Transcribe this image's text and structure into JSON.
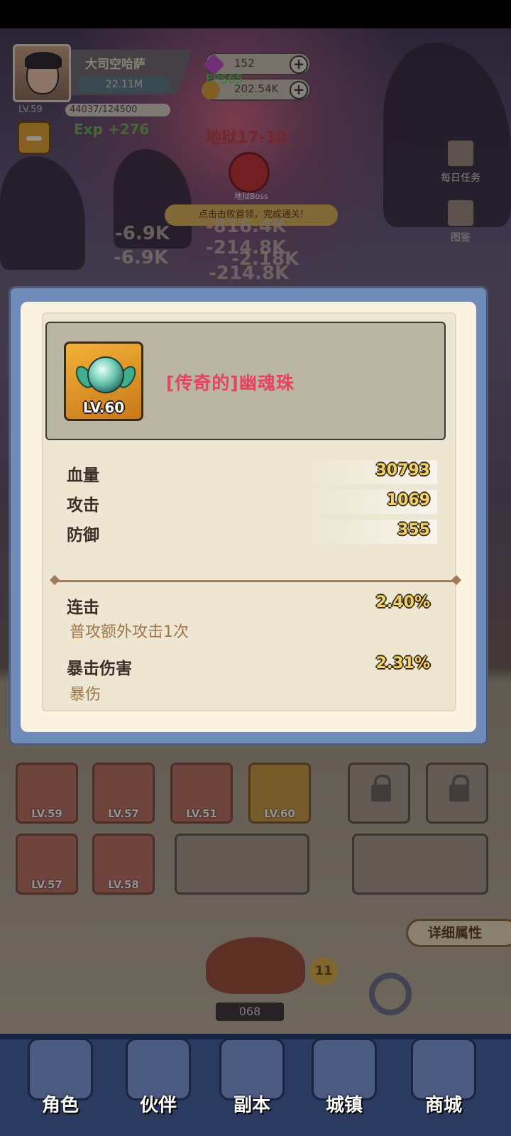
{
  "hud": {
    "player_name": "大司空哈萨",
    "power": "22.11M",
    "level": "LV.59",
    "exp": "44037/124500",
    "exp_gain": "Exp +276",
    "gems": "152",
    "gold": "202.54K",
    "fps": "FPS65",
    "stage": "地狱17-10",
    "boss_label": "地狱Boss",
    "boss_hint": "点击击败首领，完成通关!",
    "daily_tasks": "每日任务",
    "codex": "图鉴"
  },
  "damage_numbers": [
    "-6.9K",
    "-816.4K",
    "-6.9K",
    "-214.8K",
    "-2.18K",
    "-214.8K"
  ],
  "item": {
    "name": "[传奇的]幽魂珠",
    "level": "LV.60",
    "base_stats": [
      {
        "label": "血量",
        "value": "30793"
      },
      {
        "label": "攻击",
        "value": "1069"
      },
      {
        "label": "防御",
        "value": "355"
      }
    ],
    "extra_stats": [
      {
        "label": "连击",
        "value": "2.40%",
        "desc": "普攻额外攻击1次"
      },
      {
        "label": "暴击伤害",
        "value": "2.31%",
        "desc": "暴伤"
      }
    ]
  },
  "equipment": {
    "slots": [
      {
        "level": "LV.59"
      },
      {
        "level": "LV.57"
      },
      {
        "level": "LV.51"
      },
      {
        "level": "LV.60"
      },
      {
        "level": "LV.57"
      },
      {
        "level": "LV.58"
      }
    ],
    "detail_button": "详细属性",
    "counter": "068",
    "badge": "11"
  },
  "nav": [
    {
      "label": "角色"
    },
    {
      "label": "伙伴"
    },
    {
      "label": "副本"
    },
    {
      "label": "城镇"
    },
    {
      "label": "商城"
    }
  ],
  "colors": {
    "item_name": "#e8435e",
    "stat_value": "#f0d26a",
    "modal_frame": "#6f8cb8",
    "fps": "#39e83a",
    "nav_bg": "#2b3a60"
  }
}
